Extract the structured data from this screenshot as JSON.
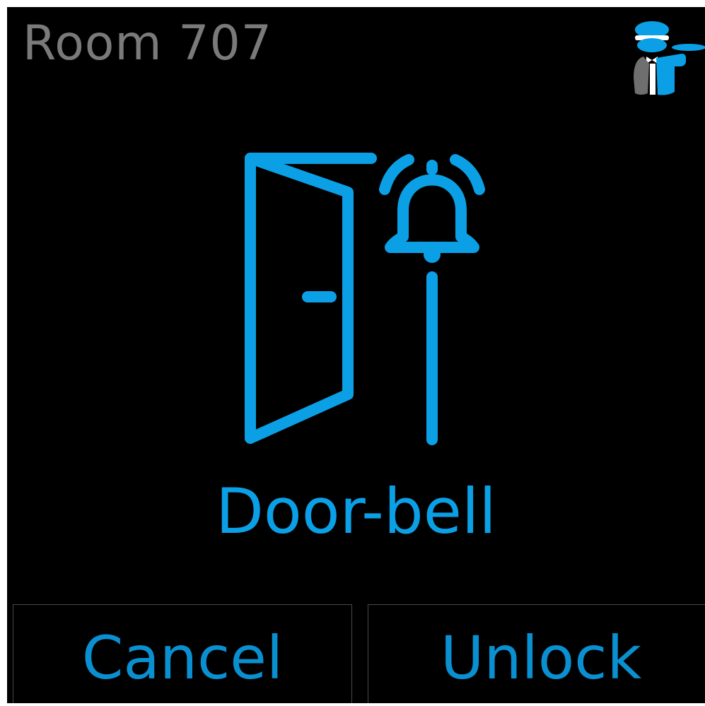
{
  "header": {
    "title": "Room 707",
    "logo_icon": "butler-icon"
  },
  "main": {
    "icon": "door-bell-icon",
    "event_label": "Door-bell"
  },
  "actions": {
    "cancel_label": "Cancel",
    "unlock_label": "Unlock"
  },
  "colors": {
    "background": "#000000",
    "accent": "#0ba0e6",
    "title": "#7a7a7a",
    "button_border": "#4a4a4a"
  }
}
